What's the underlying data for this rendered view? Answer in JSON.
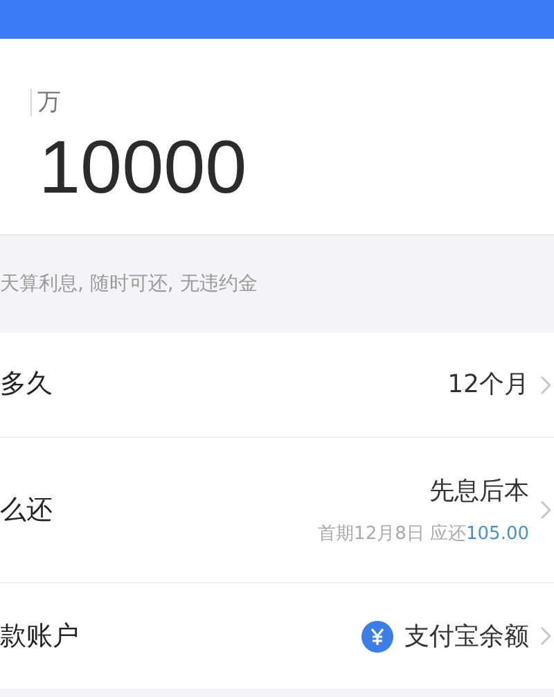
{
  "amount": {
    "unit": "万",
    "value": "10000"
  },
  "hint": "天算利息, 随时可还, 无违约金",
  "rows": [
    {
      "kind": "simple",
      "label": "多久",
      "value": "12个月"
    },
    {
      "kind": "detail",
      "label": "么还",
      "value": "先息后本",
      "note": "首期12月8日 应还",
      "amount": "105.00"
    },
    {
      "kind": "account",
      "label": "款账户",
      "value": "支付宝余额"
    }
  ]
}
